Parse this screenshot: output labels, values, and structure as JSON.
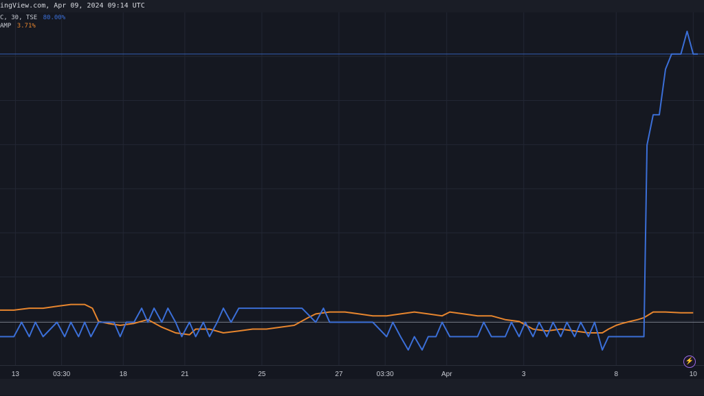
{
  "header": {
    "source_text": "ingView.com, Apr 09, 2024 09:14 UTC"
  },
  "legend": {
    "series1_label": "C, 30, TSE",
    "series1_value": "80.00%",
    "series2_label": "AMP",
    "series2_value": "3.71%"
  },
  "colors": {
    "series1": "#3b6fd8",
    "series2": "#e8862e",
    "background": "#151821",
    "grid": "#232734"
  },
  "icons": {
    "bottom_right": "lightning-icon"
  },
  "chart_data": {
    "type": "line",
    "title": "",
    "xlabel": "",
    "ylabel": "",
    "ylim": [
      -8,
      85
    ],
    "grid": true,
    "legend_position": "top-left",
    "x_ticks": [
      {
        "label": "13",
        "x": 1
      },
      {
        "label": "03:30",
        "x": 4
      },
      {
        "label": "18",
        "x": 8
      },
      {
        "label": "21",
        "x": 12
      },
      {
        "label": "25",
        "x": 17
      },
      {
        "label": "27",
        "x": 22
      },
      {
        "label": "03:30",
        "x": 25
      },
      {
        "label": "Apr",
        "x": 29
      },
      {
        "label": "3",
        "x": 34
      },
      {
        "label": "8",
        "x": 40
      },
      {
        "label": "10",
        "x": 45
      }
    ],
    "xlim": [
      0,
      45.7
    ],
    "series": [
      {
        "name": "C, 30, TSE",
        "x": [
          0,
          0.9,
          1.4,
          1.9,
          2.3,
          2.8,
          3.7,
          4.2,
          4.6,
          5.1,
          5.5,
          5.9,
          6.4,
          7.4,
          7.8,
          8.2,
          8.7,
          9.2,
          9.6,
          10.0,
          10.5,
          10.9,
          11.4,
          11.8,
          12.3,
          12.7,
          13.2,
          13.6,
          14.1,
          14.5,
          15.0,
          15.5,
          16.4,
          17.3,
          18.2,
          19.6,
          20.5,
          21.0,
          21.4,
          21.9,
          22.8,
          24.2,
          25.1,
          25.5,
          26.0,
          26.5,
          26.9,
          27.4,
          27.8,
          28.3,
          28.7,
          29.2,
          30.1,
          31.0,
          31.4,
          31.9,
          32.8,
          33.2,
          33.7,
          34.1,
          34.6,
          35.0,
          35.5,
          35.9,
          36.4,
          36.8,
          37.3,
          37.7,
          38.2,
          38.6,
          39.1,
          39.5,
          40.0,
          40.4,
          40.9,
          41.8,
          42.0,
          42.4,
          42.8,
          43.2,
          43.6,
          43.9,
          44.2,
          44.6,
          45.0,
          45.3
        ],
        "values": [
          -0.5,
          -0.5,
          3.3,
          -0.5,
          3.3,
          -0.5,
          3.3,
          -0.5,
          3.3,
          -0.5,
          3.3,
          -0.5,
          3.3,
          3.3,
          -0.5,
          3.3,
          3.3,
          7.0,
          3.3,
          7.0,
          3.3,
          7.0,
          3.3,
          -0.5,
          3.3,
          -0.5,
          3.3,
          -0.5,
          3.3,
          7.0,
          3.3,
          7.0,
          7.0,
          7.0,
          7.0,
          7.0,
          3.3,
          7.0,
          3.3,
          3.3,
          3.3,
          3.3,
          -0.5,
          3.3,
          -0.5,
          -4.0,
          -0.5,
          -4.0,
          -0.5,
          -0.5,
          3.3,
          -0.5,
          -0.5,
          -0.5,
          3.3,
          -0.5,
          -0.5,
          3.3,
          -0.5,
          3.3,
          -0.5,
          3.3,
          -0.5,
          3.3,
          -0.5,
          3.3,
          -0.5,
          3.3,
          -0.5,
          3.3,
          -4.0,
          -0.5,
          -0.5,
          -0.5,
          -0.5,
          -0.5,
          50,
          58,
          58,
          70,
          74,
          74,
          74,
          80,
          74,
          74
        ]
      },
      {
        "name": "AMP",
        "x": [
          0,
          0.9,
          1.9,
          2.8,
          3.7,
          4.6,
          5.5,
          6.0,
          6.4,
          7.0,
          7.8,
          8.7,
          9.6,
          10.5,
          11.4,
          12.3,
          12.7,
          13.6,
          14.5,
          15.5,
          16.4,
          17.3,
          18.2,
          19.1,
          20.0,
          20.5,
          21.4,
          22.4,
          23.3,
          24.2,
          25.1,
          26.0,
          26.9,
          27.8,
          28.7,
          29.2,
          30.1,
          31.0,
          31.9,
          32.8,
          33.7,
          34.6,
          35.5,
          36.4,
          37.3,
          38.2,
          39.1,
          39.5,
          40.0,
          40.4,
          40.9,
          41.4,
          41.8,
          42.4,
          43.2,
          44.2,
          45.0
        ],
        "values": [
          6.5,
          6.5,
          7.0,
          7.0,
          7.5,
          8.0,
          8.0,
          7.0,
          3.5,
          3.0,
          2.5,
          3.0,
          4.0,
          2.0,
          0.5,
          0.0,
          1.5,
          1.5,
          0.5,
          1.0,
          1.5,
          1.5,
          2.0,
          2.5,
          4.5,
          5.5,
          6.0,
          6.0,
          5.5,
          5.0,
          5.0,
          5.5,
          6.0,
          5.5,
          5.0,
          6.0,
          5.5,
          5.0,
          5.0,
          4.0,
          3.5,
          1.5,
          1.0,
          1.5,
          1.0,
          0.5,
          0.5,
          1.5,
          2.5,
          3.0,
          3.5,
          4.0,
          4.5,
          6.0,
          6.0,
          5.8,
          5.8
        ]
      }
    ],
    "reference_lines": [
      {
        "orientation": "horizontal",
        "y": 74,
        "color": "#3b6fd8"
      },
      {
        "orientation": "horizontal",
        "y": 3.3,
        "color": "#8a8f9c"
      }
    ]
  }
}
